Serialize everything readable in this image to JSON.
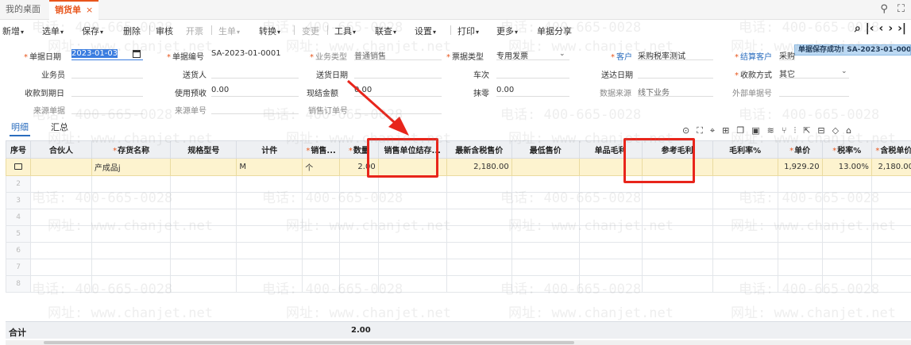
{
  "tabs": [
    {
      "label": "我的桌面"
    },
    {
      "label": "销货单",
      "close": "×"
    }
  ],
  "toolbar": {
    "items": [
      "新增",
      "选单",
      "保存",
      "删除",
      "审核",
      "开票",
      "生单",
      "转换",
      "变更",
      "工具",
      "联查",
      "设置",
      "打印",
      "更多",
      "单据分享"
    ],
    "caret": "▾"
  },
  "toast": "单据保存成功! SA-2023-01-000",
  "form": {
    "doc_date_label": "单据日期",
    "doc_date": "2023-01-03",
    "doc_no_label": "单据编号",
    "doc_no": "SA-2023-01-0001",
    "biz_type_label": "业务类型",
    "biz_type": "普通销售",
    "invoice_type_label": "票据类型",
    "invoice_type": "专用发票",
    "customer_label": "客户",
    "customer": "采购税率测试",
    "settle_label": "结算客户",
    "settle": "采购税率测试",
    "salesman_label": "业务员",
    "deliverer_label": "送货人",
    "delivery_date_label": "送货日期",
    "vehicle_label": "车次",
    "arrival_date_label": "送达日期",
    "pay_method_label": "收款方式",
    "pay_method": "其它",
    "due_date_label": "收款到期日",
    "prepay_label": "使用预收",
    "prepay": "0.00",
    "cash_label": "现结金额",
    "cash": "0.00",
    "rounding_label": "抹零",
    "rounding": "0.00",
    "data_source_label": "数据来源",
    "data_source": "线下业务",
    "ext_no_label": "外部单据号",
    "source_doc_label": "来源单据",
    "source_no_label": "来源单号",
    "sales_order_label": "销售订单号"
  },
  "subtabs": [
    "明细",
    "汇总"
  ],
  "grid": {
    "headers": [
      "序号",
      "合伙人",
      "存货名称",
      "规格型号",
      "计件",
      "销售...",
      "数量",
      "销售单位结存...",
      "最新含税售价",
      "最低售价",
      "单品毛利",
      "参考毛利",
      "毛利率%",
      "单价",
      "税率%",
      "含税单价"
    ],
    "required": [
      false,
      false,
      true,
      false,
      false,
      true,
      true,
      false,
      false,
      false,
      false,
      false,
      false,
      true,
      true,
      true
    ],
    "row1": [
      "",
      "",
      "产成品j",
      "",
      "M",
      "个",
      "2.00",
      "",
      "2,180.00",
      "",
      "",
      "",
      "",
      "1,929.20",
      "13.00%",
      "2,180.00"
    ],
    "empty_rows": [
      "2",
      "3",
      "4",
      "5",
      "6",
      "7",
      "8"
    ]
  },
  "footer": {
    "label": "合计",
    "total_qty": "2.00"
  },
  "watermark": {
    "phone": "电话: 400-665-0028",
    "site": "网址: www.chanjet.net"
  }
}
